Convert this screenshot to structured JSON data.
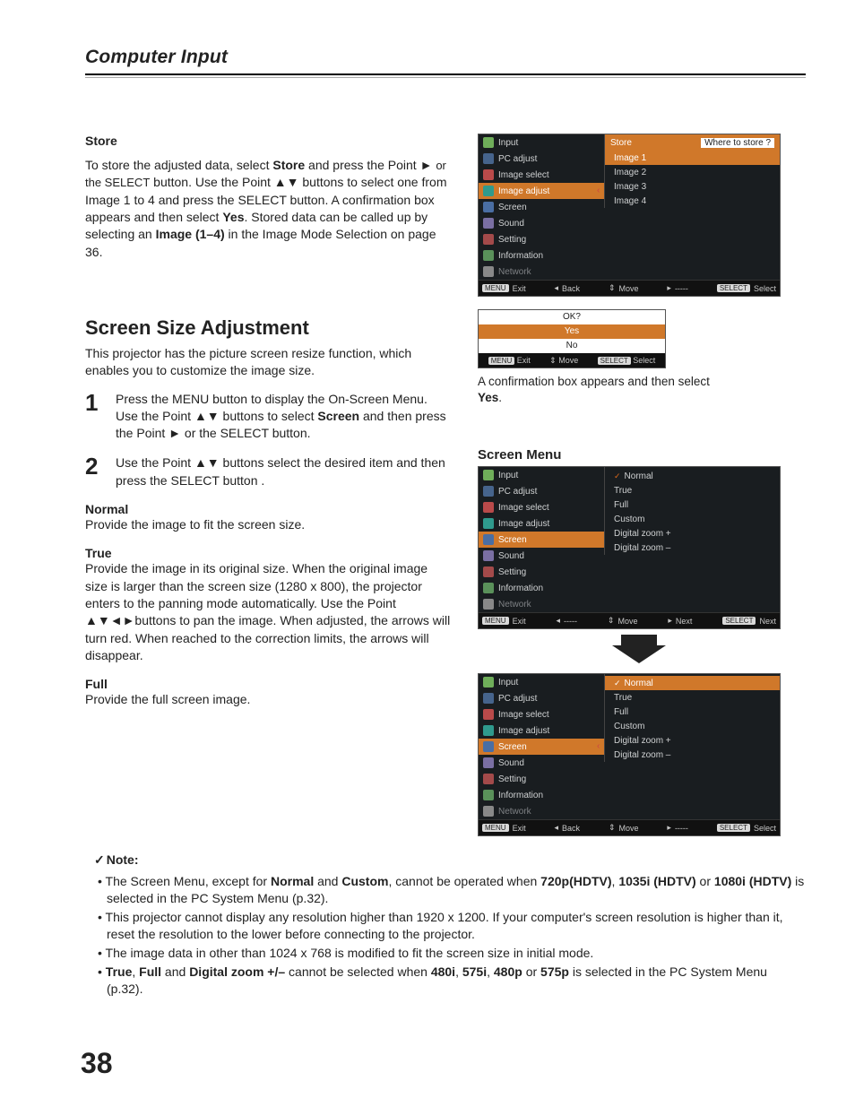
{
  "page_number": "38",
  "header": {
    "title": "Computer Input"
  },
  "store": {
    "heading": "Store",
    "p1a": "To store the adjusted data, select ",
    "p1b": "Store",
    "p1c": " and press the Point ► ",
    "p1d": "or the SELECT",
    "p1e": " button. Use the Point ▲▼ buttons to select one from Image 1 to 4 and press the SELECT button. A confirmation box appears and then select ",
    "p1f": "Yes",
    "p1g": ". Stored data can be called up by selecting an ",
    "p1h": "Image (1–4)",
    "p1i": " in the Image Mode Selection on page 36."
  },
  "ssa": {
    "heading": "Screen Size Adjustment",
    "intro": "This projector has the picture screen resize function, which enables you to customize the image size.",
    "step1a": "Press the MENU button to display the On-Screen Menu. Use the Point ▲▼ buttons to select ",
    "step1b": "Screen",
    "step1c": " and then press the Point ► ",
    "step1d": "or the SELECT",
    "step1e": " button.",
    "step2": "Use the Point ▲▼ buttons select the desired item and then press the SELECT button .",
    "normal_h": "Normal",
    "normal_p": "Provide the image to fit the screen size.",
    "true_h": "True",
    "true_p": "Provide the image in its original size. When the original image size is larger than the screen size (1280 x 800), the projector enters to the panning mode automatically. Use the Point ▲▼◄►buttons to pan the image. When adjusted, the arrows will turn red. When reached to the correction limits, the arrows will disappear.",
    "full_h": "Full",
    "full_p": "Provide the full screen image."
  },
  "osd_main_menu_items": [
    "Input",
    "PC adjust",
    "Image select",
    "Image adjust",
    "Screen",
    "Sound",
    "Setting",
    "Information",
    "Network"
  ],
  "osd1": {
    "sub_header_left": "Store",
    "sub_header_right": "Where to store ?",
    "sub_items": [
      "Image 1",
      "Image 2",
      "Image 3",
      "Image 4"
    ],
    "highlight_row": "Image adjust",
    "nav": {
      "exit_key": "MENU",
      "exit": "Exit",
      "back": "Back",
      "move": "Move",
      "dash": "-----",
      "sel_key": "SELECT",
      "sel": "Select"
    }
  },
  "confirm": {
    "q": "OK?",
    "yes": "Yes",
    "no": "No",
    "nav": {
      "exit_key": "MENU",
      "exit": "Exit",
      "move": "Move",
      "sel_key": "SELECT",
      "sel": "Select"
    }
  },
  "caption1a": "A confirmation box appears and then select ",
  "caption1b": "Yes",
  "caption1c": ".",
  "screen_menu_h": "Screen Menu",
  "osd2": {
    "highlight_row": "Screen",
    "sub_items": [
      "Normal",
      "True",
      "Full",
      "Custom",
      "Digital zoom +",
      "Digital zoom –"
    ],
    "nav": {
      "exit_key": "MENU",
      "exit": "Exit",
      "dash1": "-----",
      "move": "Move",
      "next": "Next",
      "sel_key": "SELECT",
      "sel": "Next"
    }
  },
  "osd3": {
    "highlight_row": "Screen",
    "sub_items": [
      "Normal",
      "True",
      "Full",
      "Custom",
      "Digital zoom +",
      "Digital zoom –"
    ],
    "nav": {
      "exit_key": "MENU",
      "exit": "Exit",
      "back": "Back",
      "move": "Move",
      "dash": "-----",
      "sel_key": "SELECT",
      "sel": "Select"
    }
  },
  "arrow_char": "▼",
  "notes": {
    "heading": "Note:",
    "n1a": "The Screen Menu, except for ",
    "n1b": "Normal",
    "n1c": " and ",
    "n1d": "Custom",
    "n1e": ", cannot be operated when ",
    "n1f": "720p(HDTV)",
    "n1g": ", ",
    "n1h": "1035i (HDTV)",
    "n1i": " or ",
    "n1j": "1080i (HDTV)",
    "n1k": "  is selected in the PC System Menu (p.32).",
    "n2": "This projector cannot display any resolution higher than 1920 x 1200. If your computer's screen resolution is higher than it, reset the resolution to the lower before connecting to the projector.",
    "n3": "The image data in other than 1024 x 768 is modified to fit the screen size in initial mode.",
    "n4a": "True",
    "n4b": ", ",
    "n4c": "Full",
    "n4d": " and ",
    "n4e": "Digital zoom +/–",
    "n4f": " cannot be selected when ",
    "n4g": "480i",
    "n4h": ", ",
    "n4i": "575i",
    "n4j": ", ",
    "n4k": "480p",
    "n4l": " or ",
    "n4m": "575p",
    "n4n": " is selected in the PC System Menu (p.32)."
  },
  "glyphs": {
    "point_right": "►",
    "point_ud": "▲▼",
    "point_all": "▲▼◄►",
    "check": "✓",
    "chev_right": "›",
    "chev_left": "‹",
    "tri_left": "◂",
    "tri_right": "▸",
    "updown": "⇕"
  }
}
